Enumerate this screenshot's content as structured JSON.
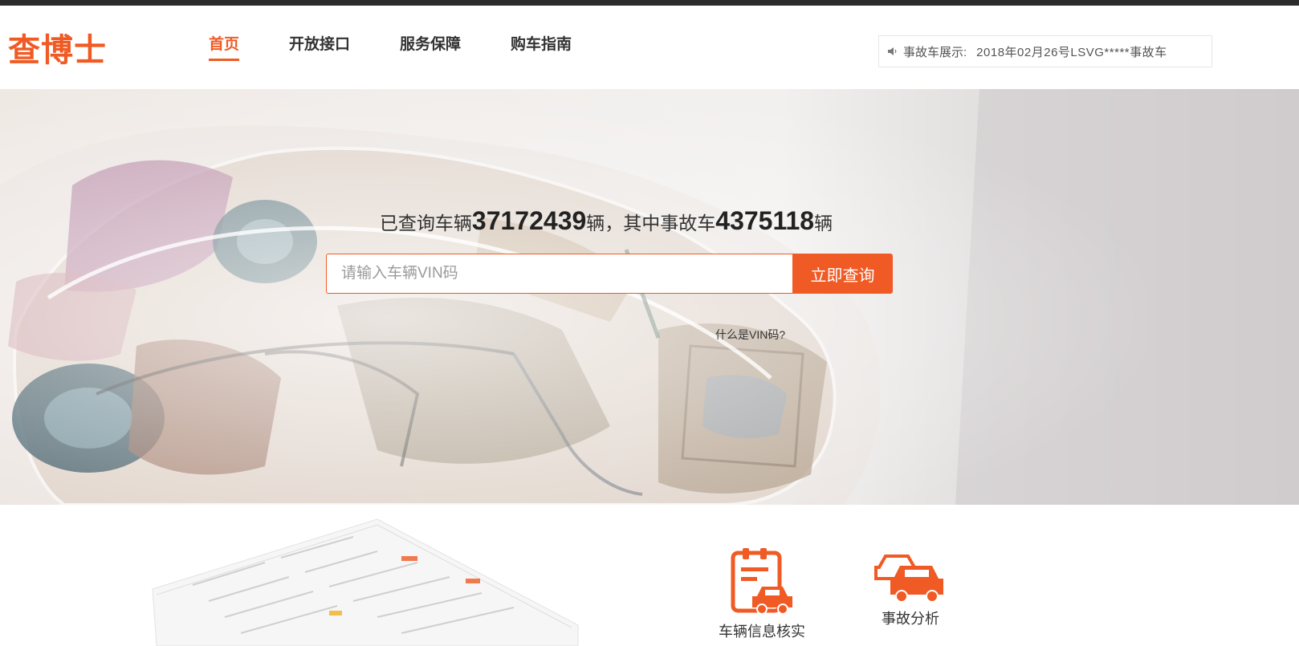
{
  "brand": {
    "logo_text": "查博士",
    "accent_color": "#f05a24"
  },
  "nav": {
    "items": [
      {
        "label": "首页",
        "active": true
      },
      {
        "label": "开放接口",
        "active": false
      },
      {
        "label": "服务保障",
        "active": false
      },
      {
        "label": "购车指南",
        "active": false
      }
    ]
  },
  "ticker": {
    "icon": "speaker-icon",
    "label": "事故车展示:",
    "text": "2018年02月26号LSVG*****事故车"
  },
  "hero": {
    "stats_prefix": "已查询车辆",
    "queried_count": "37172439",
    "stats_mid": "辆，其中事故车",
    "accident_count": "4375118",
    "stats_suffix": "辆",
    "search_placeholder": "请输入车辆VIN码",
    "search_button": "立即查询",
    "vin_help": "什么是VIN码?"
  },
  "features": [
    {
      "icon": "clipboard-car-icon",
      "label": "车辆信息核实"
    },
    {
      "icon": "car-crash-icon",
      "label": "事故分析"
    }
  ]
}
